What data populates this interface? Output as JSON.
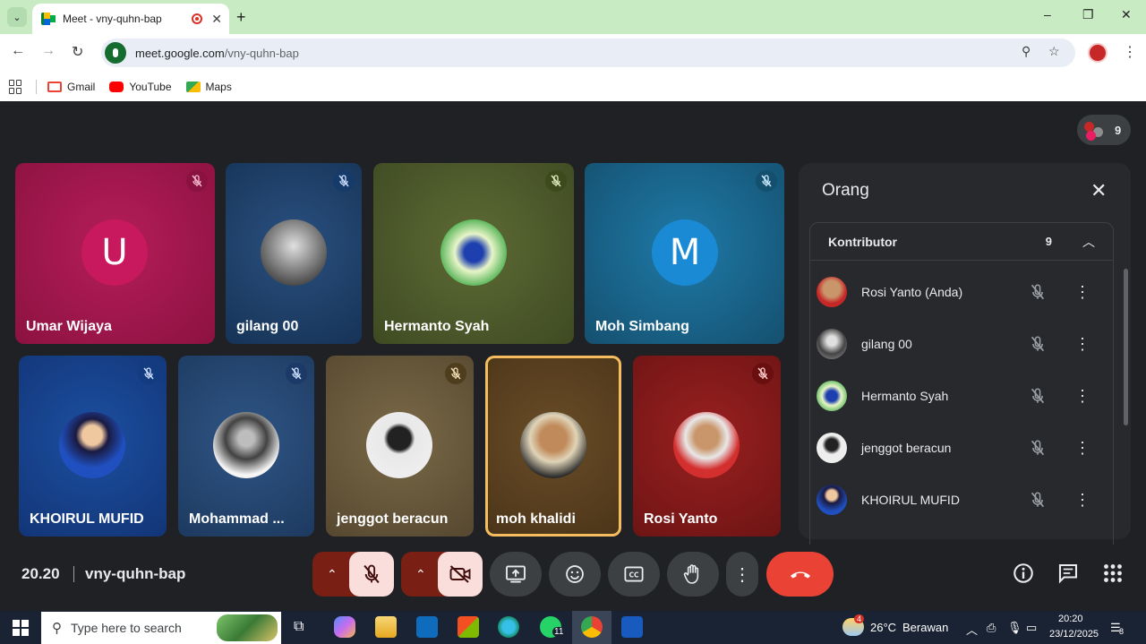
{
  "browser": {
    "tab_title": "Meet - vny-quhn-bap",
    "tab_close": "✕",
    "new_tab": "+",
    "window_controls": [
      "–",
      "❐",
      "✕"
    ],
    "url_host": "meet.google.com",
    "url_path": "/vny-quhn-bap",
    "bookmarks": [
      {
        "label": "Gmail",
        "color": "#ea4335"
      },
      {
        "label": "YouTube",
        "color": "#ff0000"
      },
      {
        "label": "Maps",
        "color": "#34a853"
      }
    ]
  },
  "meet": {
    "participant_count": "9",
    "tiles_row1": [
      {
        "name": "Umar Wijaya",
        "bg": "#a3154f",
        "avatar_letter": "U",
        "avatar_color": "#c2185b"
      },
      {
        "name": "gilang 00",
        "bg": "#1f3d66"
      },
      {
        "name": "Hermanto Syah",
        "bg": "#4c5a2a"
      },
      {
        "name": "Moh Simbang",
        "bg": "#1c5f86",
        "avatar_letter": "M",
        "avatar_color": "#1a8ad4"
      }
    ],
    "tiles_row2": [
      {
        "name": "KHOIRUL MUFID",
        "bg": "#14408a"
      },
      {
        "name": "Mohammad ...",
        "bg": "#25426a"
      },
      {
        "name": "jenggot beracun",
        "bg": "#6a5a3a"
      },
      {
        "name": "moh khalidi",
        "bg": "#5a4020"
      },
      {
        "name": "Rosi Yanto",
        "bg": "#8a1d1d"
      }
    ],
    "panel": {
      "title": "Orang",
      "section_title": "Kontributor",
      "section_count": "9",
      "people": [
        {
          "name": "Rosi Yanto (Anda)",
          "color": "#c62828"
        },
        {
          "name": "gilang 00",
          "color": "#777777"
        },
        {
          "name": "Hermanto Syah",
          "color": "#2e7d32"
        },
        {
          "name": "jenggot beracun",
          "color": "#e0e0e0"
        },
        {
          "name": "KHOIRUL MUFID",
          "color": "#1e3a8a"
        }
      ]
    },
    "time": "20.20",
    "meeting_code": "vny-quhn-bap"
  },
  "taskbar": {
    "search_placeholder": "Type here to search",
    "whatsapp_badge": "11",
    "weather_temp": "26°C",
    "weather_text": "Berawan",
    "weather_badge": "4",
    "clock_time": "20:20",
    "clock_date": "23/12/2025",
    "notification_count": "8"
  }
}
